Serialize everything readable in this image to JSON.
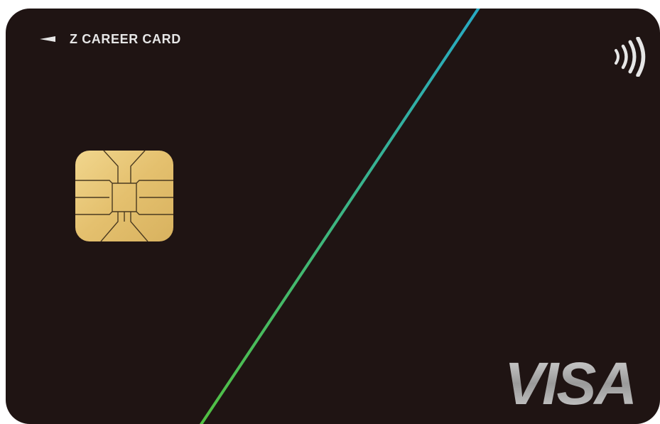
{
  "card": {
    "brand_name": "Z CAREER CARD",
    "network_name": "VISA",
    "colors": {
      "body": "#1f1413",
      "stripe_top": "#27a9c4",
      "stripe_bottom": "#52c041",
      "text": "#e6e6e6",
      "chip": "#e8c87a"
    },
    "icons": {
      "brand_mark": "left-arrow-icon",
      "contactless": "contactless-icon",
      "chip": "emv-chip-icon"
    }
  }
}
